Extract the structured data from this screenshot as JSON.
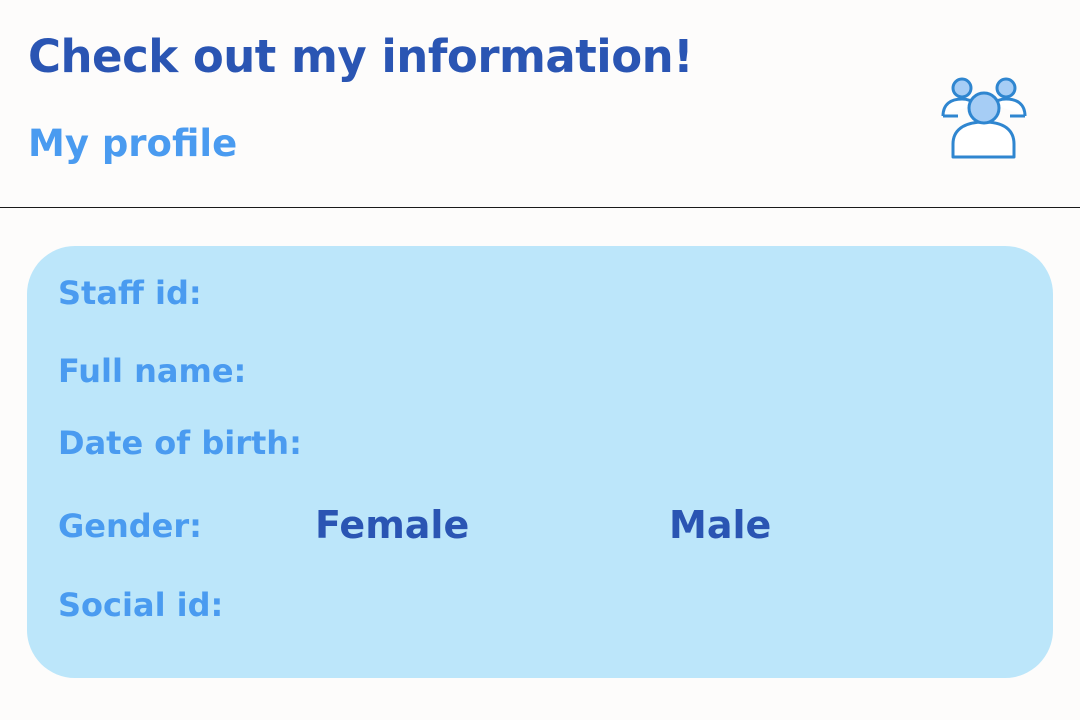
{
  "header": {
    "title": "Check out my information!",
    "subtitle": "My profile",
    "icon": "users-group-icon"
  },
  "profile": {
    "staff_id_label": "Staff id:",
    "full_name_label": "Full name:",
    "date_of_birth_label": "Date of birth:",
    "gender_label": "Gender:",
    "gender_options": [
      "Female",
      "Male"
    ],
    "social_id_label": "Social id:"
  },
  "colors": {
    "background": "#fdfcfb",
    "card": "#bce6fa",
    "title": "#2a55b3",
    "label": "#4a9bf0",
    "icon_stroke": "#2f86d0",
    "icon_fill": "#a6cdf5"
  }
}
